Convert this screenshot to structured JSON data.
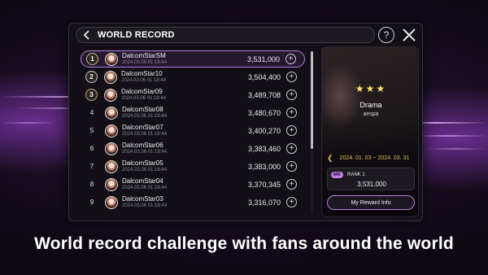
{
  "header": {
    "title": "WORLD RECORD"
  },
  "icons": {
    "back": "chevron-left-icon",
    "help": "question-circle-icon",
    "close": "close-x-icon",
    "add": "plus-circle-icon",
    "star": "star-icon"
  },
  "colors": {
    "accent": "#b77fdc",
    "period": "#e7b85c",
    "stars": "#ffe36b"
  },
  "help_glyph": "?",
  "leaderboard": [
    {
      "rank": "1",
      "name": "DalcomStarSM",
      "date": "2024.03.06 01:18:44",
      "score": "3,531,000",
      "medal": "gold"
    },
    {
      "rank": "2",
      "name": "DalcomStar10",
      "date": "2024.03.06 01:18:44",
      "score": "3,504,400",
      "medal": "silver"
    },
    {
      "rank": "3",
      "name": "DalcomStar09",
      "date": "2024.03.06 01:18:44",
      "score": "3,489,708",
      "medal": "bronze"
    },
    {
      "rank": "4",
      "name": "DalcomStar08",
      "date": "2024.03.06 01:18:44",
      "score": "3,480,670",
      "medal": ""
    },
    {
      "rank": "5",
      "name": "DalcomStar07",
      "date": "2024.03.06 01:18:44",
      "score": "3,400,270",
      "medal": ""
    },
    {
      "rank": "6",
      "name": "DalcomStar06",
      "date": "2024.03.06 01:18:44",
      "score": "3,383,460",
      "medal": ""
    },
    {
      "rank": "7",
      "name": "DalcomStar05",
      "date": "2024.03.06 01:18:44",
      "score": "3,383,000",
      "medal": ""
    },
    {
      "rank": "8",
      "name": "DalcomStar04",
      "date": "2024.03.06 01:18:44",
      "score": "3,370,345",
      "medal": ""
    },
    {
      "rank": "9",
      "name": "DalcomStar03",
      "date": "2024.03.06 01:18:44",
      "score": "3,316,070",
      "medal": ""
    }
  ],
  "song": {
    "stars": "★★★",
    "title": "Drama",
    "artist": "aespa",
    "period": "2024. 01. 03 ~ 2024. 03. 31",
    "badge": "MR",
    "rank_label": "RANK 1",
    "my_score": "3,531,000",
    "reward_button": "My Reward Info"
  },
  "caption": "World record challenge with fans around the world"
}
